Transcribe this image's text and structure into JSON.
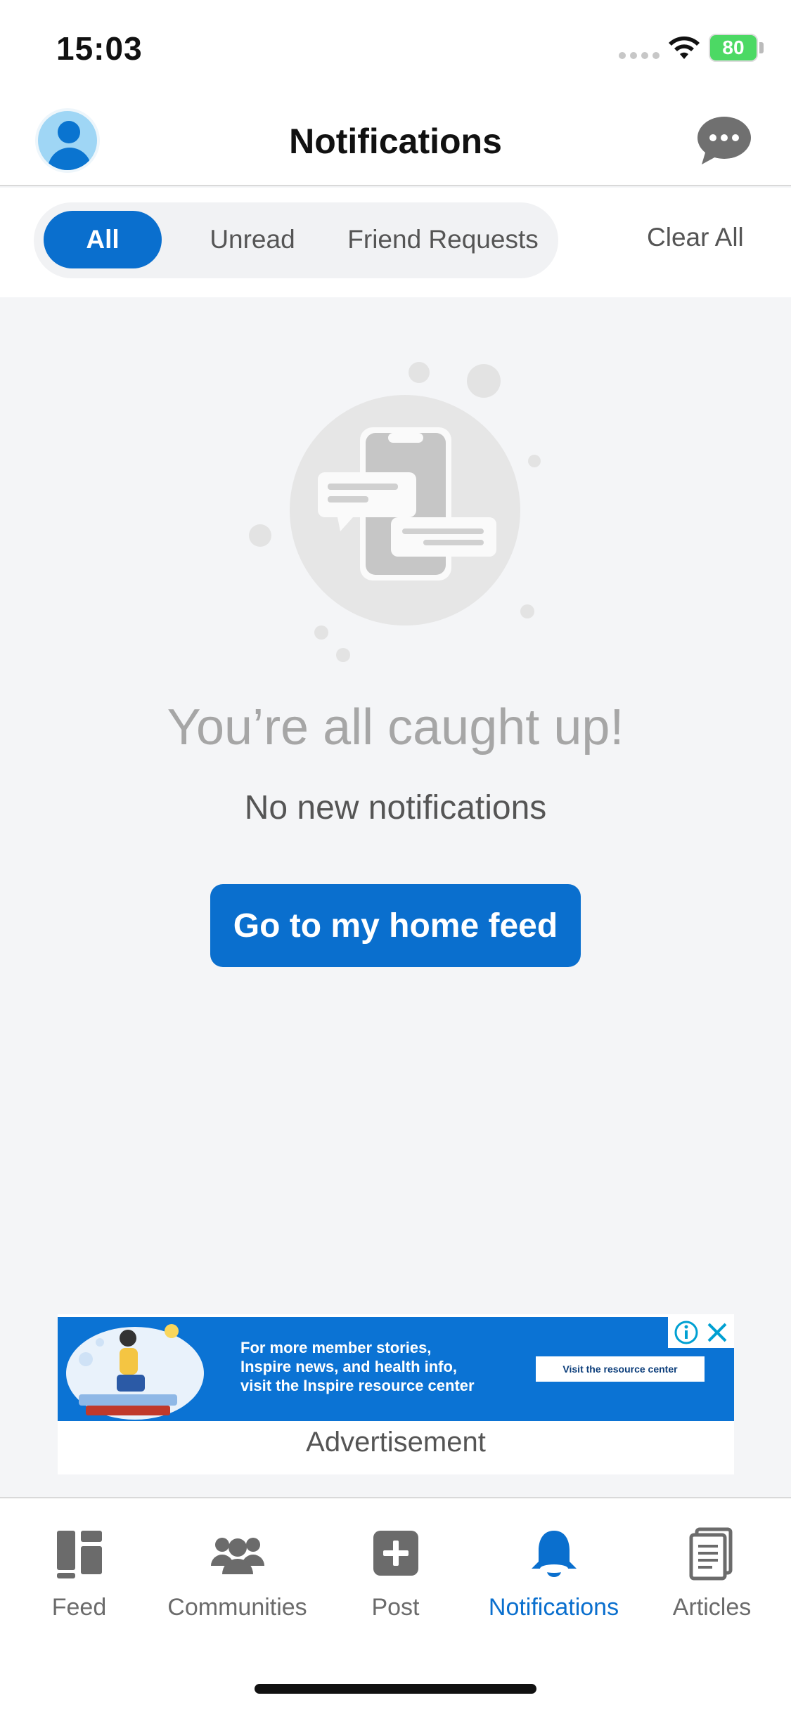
{
  "status_bar": {
    "time": "15:03",
    "battery": "80"
  },
  "header": {
    "title": "Notifications",
    "avatar_icon": "user-avatar-icon",
    "chat_icon": "chat-bubble-icon"
  },
  "filters": {
    "tabs": [
      {
        "label": "All",
        "active": true
      },
      {
        "label": "Unread",
        "active": false
      },
      {
        "label": "Friend Requests",
        "active": false
      }
    ],
    "clear_all": "Clear All"
  },
  "empty_state": {
    "title": "You’re all caught up!",
    "subtitle": "No new notifications",
    "button": "Go to my home feed"
  },
  "advertisement": {
    "lines": [
      "For more member stories,",
      "Inspire news, and health info,",
      "visit the Inspire resource center"
    ],
    "cta": "Visit the resource center",
    "label": "Advertisement"
  },
  "bottom_nav": {
    "items": [
      {
        "label": "Feed",
        "icon": "feed-icon",
        "active": false
      },
      {
        "label": "Communities",
        "icon": "communities-icon",
        "active": false
      },
      {
        "label": "Post",
        "icon": "plus-square-icon",
        "active": false
      },
      {
        "label": "Notifications",
        "icon": "bell-icon",
        "active": true
      },
      {
        "label": "Articles",
        "icon": "articles-icon",
        "active": false
      }
    ]
  },
  "colors": {
    "accent": "#0a6fce",
    "background": "#f4f5f7",
    "battery": "#4cd964"
  }
}
